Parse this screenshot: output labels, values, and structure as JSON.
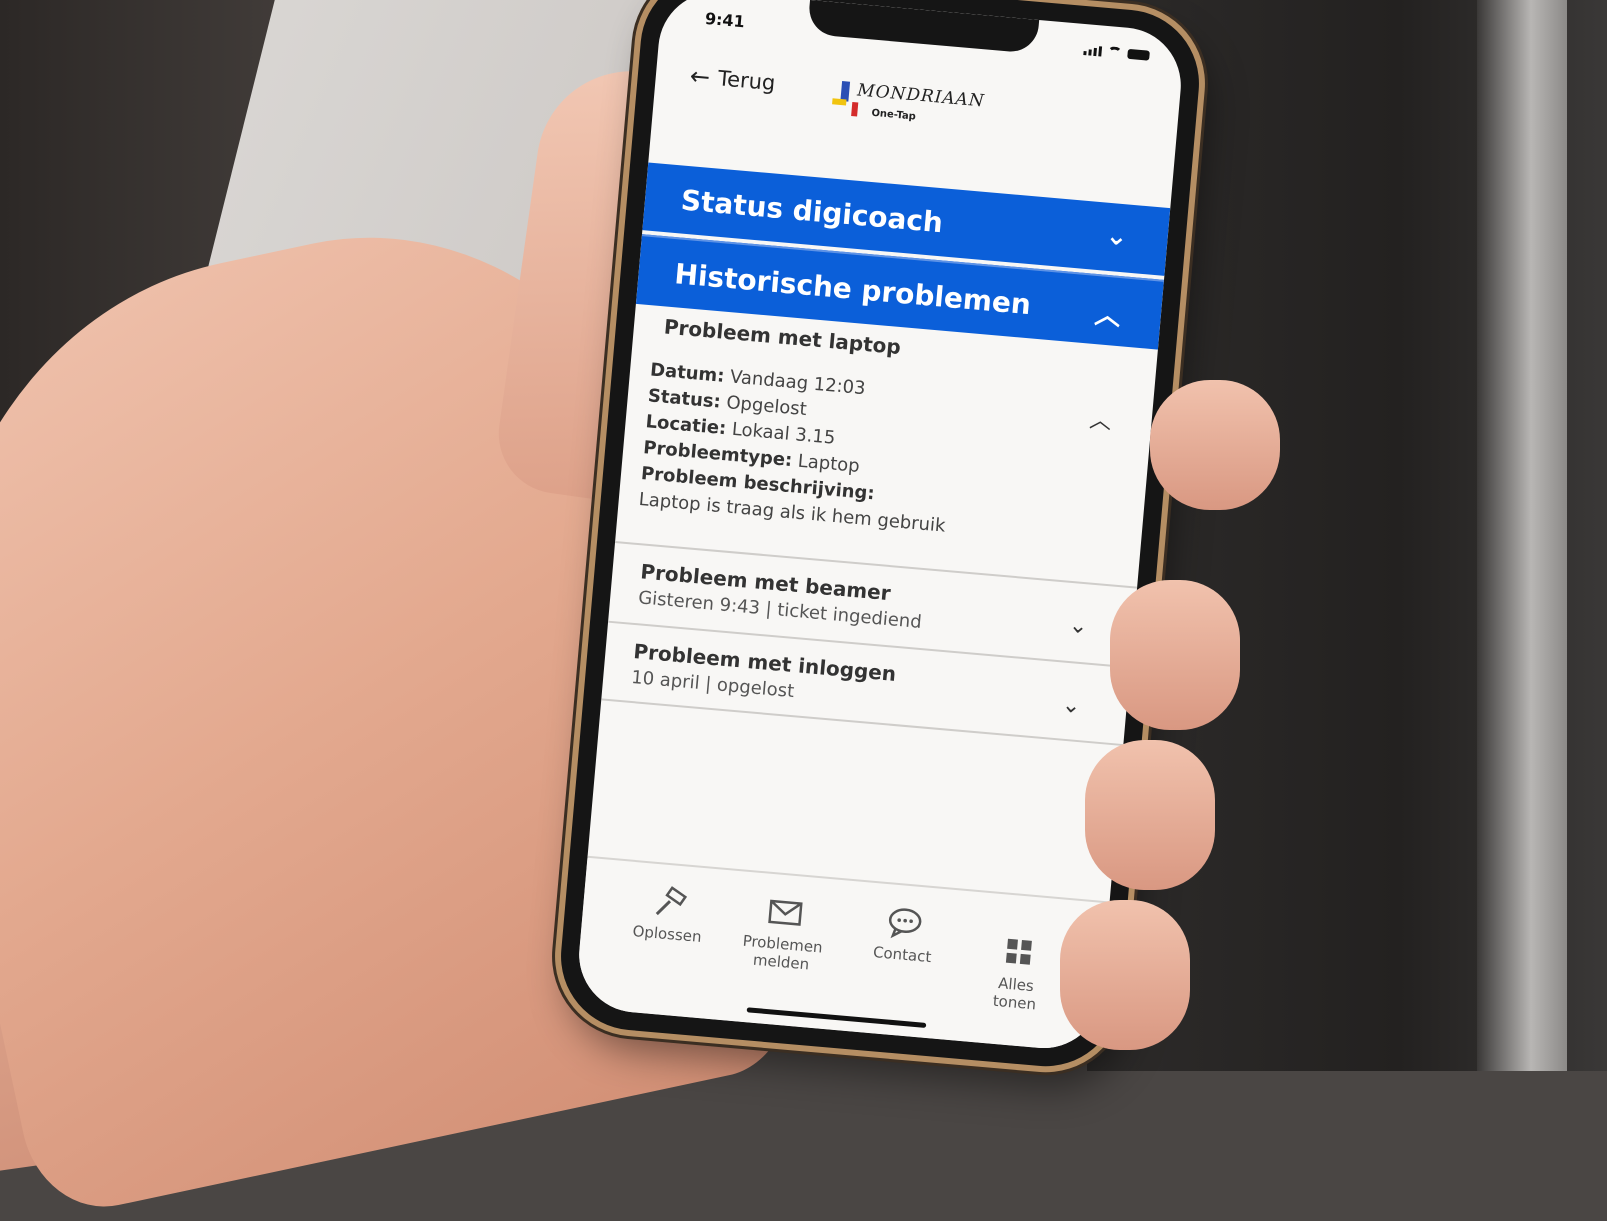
{
  "status_bar": {
    "time": "9:41"
  },
  "header": {
    "back_label": "Terug",
    "logo_name": "MONDRIAAN",
    "logo_sub": "One-Tap"
  },
  "sections": [
    {
      "title": "Status digicoach",
      "expanded": false
    },
    {
      "title": "Historische problemen",
      "expanded": true
    }
  ],
  "problems": {
    "open": {
      "title": "Probleem met laptop",
      "fields": [
        {
          "label": "Datum:",
          "value": "Vandaag 12:03"
        },
        {
          "label": "Status:",
          "value": "Opgelost"
        },
        {
          "label": "Locatie:",
          "value": "Lokaal 3.15"
        },
        {
          "label": "Probleemtype:",
          "value": "Laptop"
        },
        {
          "label": "Probleem beschrijving:",
          "value": ""
        }
      ],
      "description": "Laptop is traag als ik hem gebruik"
    },
    "items": [
      {
        "title": "Probleem met beamer",
        "subtitle": "Gisteren  9:43 | ticket ingediend"
      },
      {
        "title": "Probleem met inloggen",
        "subtitle": "10 april | opgelost"
      }
    ]
  },
  "tabs": [
    {
      "label": "Oplossen",
      "icon": "hammer-icon"
    },
    {
      "label_line1": "Problemen",
      "label_line2": "melden",
      "icon": "envelope-icon"
    },
    {
      "label": "Contact",
      "icon": "chat-bubble-icon"
    },
    {
      "label_line1": "Alles",
      "label_line2": "tonen",
      "icon": "grid-icon"
    }
  ],
  "colors": {
    "accent": "#0b5fd9",
    "screen_bg": "#f8f7f5"
  }
}
